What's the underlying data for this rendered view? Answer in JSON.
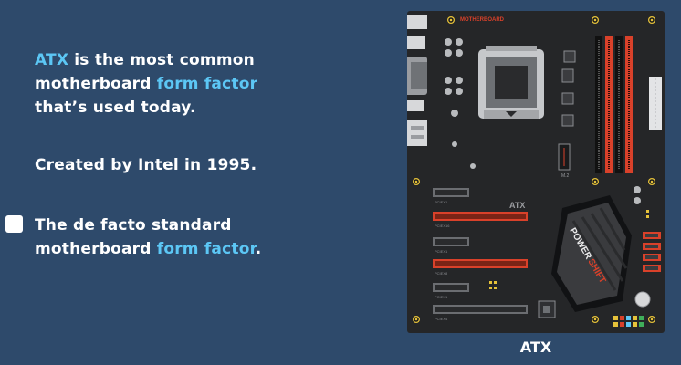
{
  "slide": {
    "intro": {
      "term": "ATX",
      "text1": " is the most common motherboard ",
      "term2": "form factor",
      "text2": " that’s used today."
    },
    "created": "Created by Intel in 1995.",
    "standard": {
      "text1": "The de facto standard motherboard ",
      "term": "form factor",
      "text2": "."
    },
    "checkbox_checked": false
  },
  "board": {
    "caption": "ATX",
    "brand_logo": "MOTHERBOARD",
    "model_label": "ATX",
    "heatsink_label_a": "POWER",
    "heatsink_label_b": "SHIFT",
    "m2_label": "M.2",
    "slot_labels": [
      "PCIEX1",
      "PCIEX16",
      "PCIEX1",
      "PCIEX8",
      "PCIEX1",
      "PCIEX4"
    ],
    "colors": {
      "pcb": "#252628",
      "accent_red": "#d9412a",
      "heatsink": "#3a3b3e",
      "highlight": "#5cc7f5"
    }
  }
}
